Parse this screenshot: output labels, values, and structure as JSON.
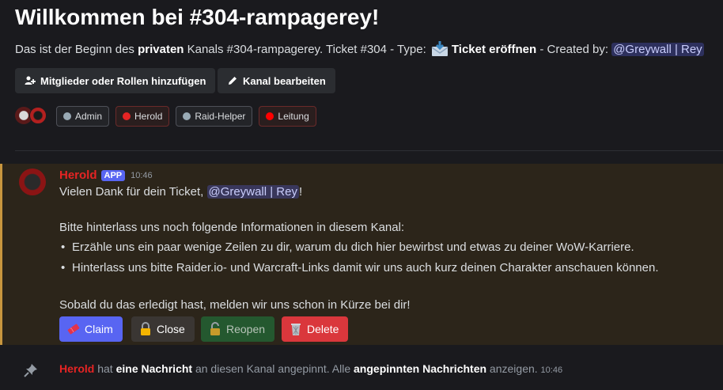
{
  "header": {
    "title": "Willkommen bei #304-rampagerey!",
    "subtitle_prefix": "Das ist der Beginn des ",
    "subtitle_bold": "privaten",
    "subtitle_mid": " Kanals #304-rampagerey. Ticket #304 - Type: ",
    "subtitle_ticket": "Ticket eröffnen",
    "subtitle_created": " - Created by: ",
    "subtitle_mention": "@Greywall | Rey",
    "ticket_emoji": "envelope-with-arrow-icon"
  },
  "actions": {
    "add_members": "Mitglieder oder Rollen hinzufügen",
    "edit_channel": "Kanal bearbeiten"
  },
  "roles": [
    {
      "label": "Admin",
      "color": "#99aab5"
    },
    {
      "label": "Herold",
      "color": "#e62424"
    },
    {
      "label": "Raid-Helper",
      "color": "#99aab5"
    },
    {
      "label": "Leitung",
      "color": "#ff0000"
    }
  ],
  "message": {
    "author": "Herold",
    "author_color": "#e62424",
    "tag": "APP",
    "time": "10:46",
    "line1_prefix": "Vielen Dank für dein Ticket, ",
    "line1_mention": "@Greywall | Rey",
    "line1_suffix": "!",
    "line2": "Bitte hinterlass uns noch folgende Informationen in diesem Kanal:",
    "bullets": [
      "Erzähle uns ein paar wenige Zeilen zu dir, warum du dich hier bewirbst und etwas zu deiner WoW-Karriere.",
      "Hinterlass uns bitte Raider.io- und Warcraft-Links damit wir uns auch kurz deinen Charakter anschauen können."
    ],
    "line_end": "Sobald du das erledigt hast, melden wir uns schon in Kürze bei dir!",
    "buttons": [
      {
        "label": "Claim",
        "icon": "ticket-icon",
        "bg": "#5865f2"
      },
      {
        "label": "Close",
        "icon": "lock-icon",
        "bg": "#3a3633"
      },
      {
        "label": "Reopen",
        "icon": "unlock-icon",
        "bg": "#24582f"
      },
      {
        "label": "Delete",
        "icon": "wastebasket-icon",
        "bg": "#da373c"
      }
    ]
  },
  "pin": {
    "author": "Herold",
    "t1": " hat ",
    "b1": "eine Nachricht",
    "t2": " an diesen Kanal angepinnt. Alle ",
    "b2": "angepinnten Nachrichten",
    "t3": " anzeigen. ",
    "time": "10:46"
  }
}
